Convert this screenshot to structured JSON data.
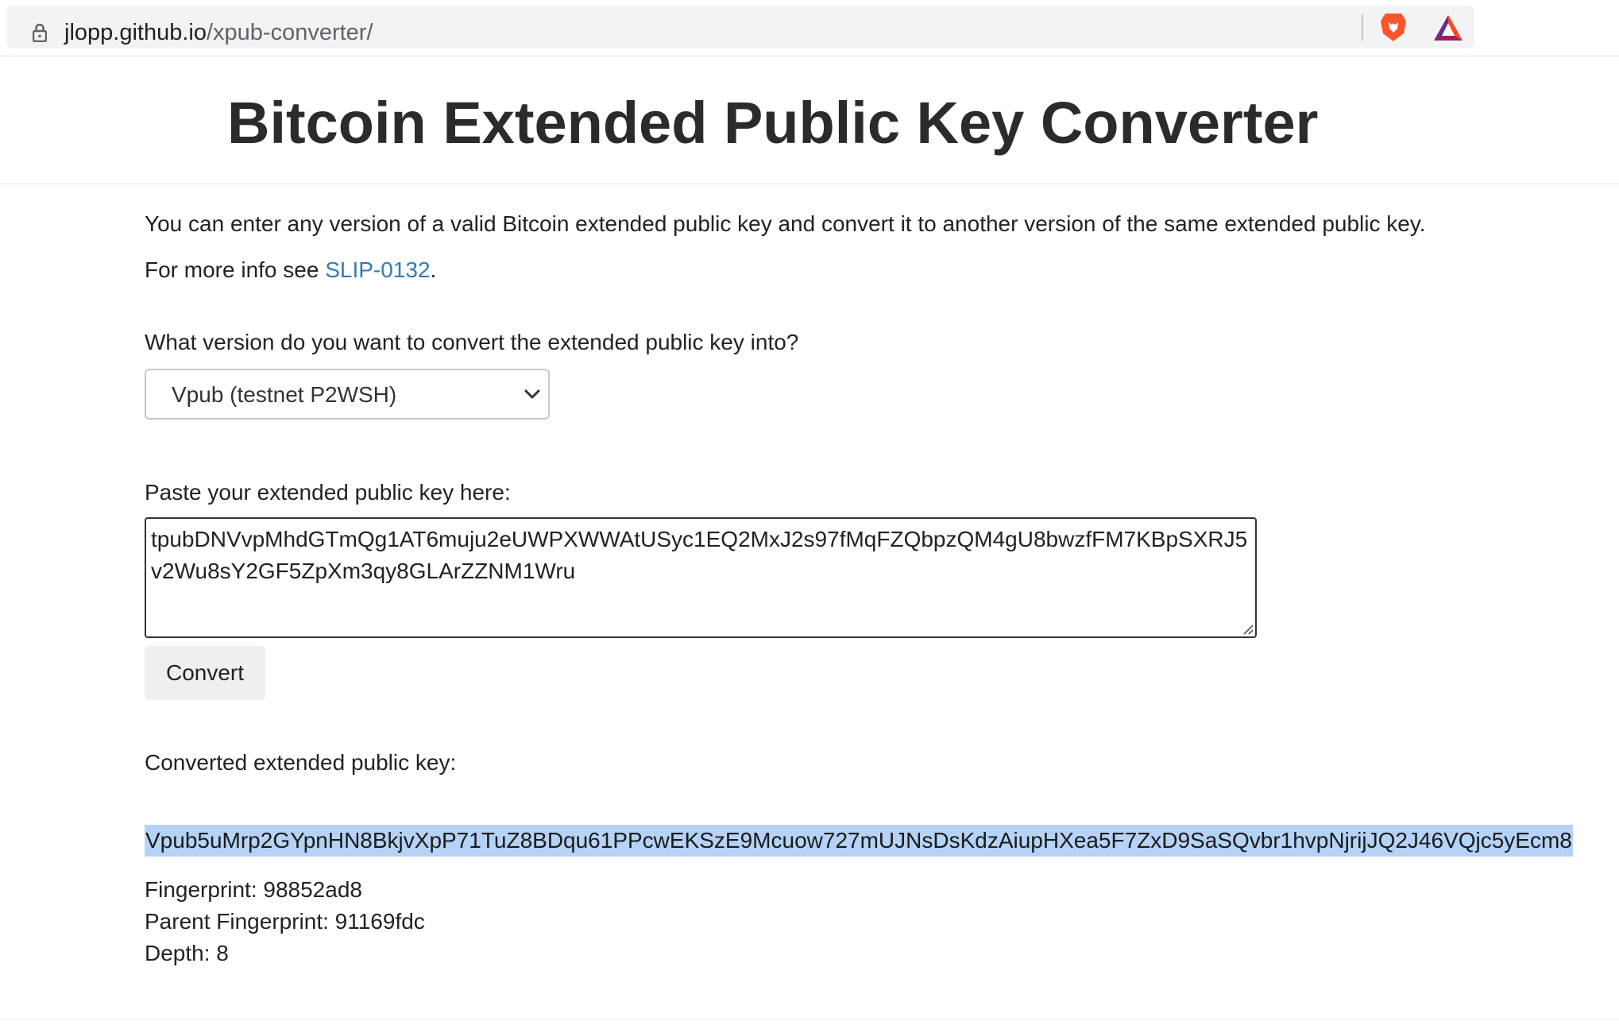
{
  "browser": {
    "url_domain": "jlopp.github.io",
    "url_path": "/xpub-converter/"
  },
  "page": {
    "title": "Bitcoin Extended Public Key Converter",
    "intro": "You can enter any version of a valid Bitcoin extended public key and convert it to another version of the same extended public key.",
    "more_info_prefix": "For more info see ",
    "more_info_link": "SLIP-0132",
    "more_info_suffix": ".",
    "version_question": "What version do you want to convert the extended public key into?",
    "version_selected": "Vpub (testnet P2WSH)",
    "paste_label": "Paste your extended public key here:",
    "input_value": "tpubDNVvpMhdGTmQg1AT6muju2eUWPXWWAtUSyc1EQ2MxJ2s97fMqFZQbpzQM4gU8bwzfFM7KBpSXRJ5v2Wu8sY2GF5ZpXm3qy8GLArZZNM1Wru",
    "convert_label": "Convert",
    "converted_label": "Converted extended public key:",
    "converted_value": "Vpub5uMrp2GYpnHN8BkjvXpP71TuZ8BDqu61PPcwEKSzE9Mcuow727mUJNsDsKdzAiupHXea5F7ZxD9SaSQvbr1hvpNjrijJQ2J46VQjc5yEcm8",
    "fingerprint": "Fingerprint: 98852ad8",
    "parent_fingerprint": "Parent Fingerprint: 91169fdc",
    "depth": "Depth: 8"
  },
  "colors": {
    "link": "#337ab7",
    "selection": "#b4d3f6",
    "button_bg": "#efefef"
  },
  "icons": {
    "lock": "lock-icon",
    "brave": "brave-lion-icon",
    "bat": "bat-triangle-icon",
    "chevron": "chevron-down-icon",
    "grip": "resize-grip-icon"
  }
}
